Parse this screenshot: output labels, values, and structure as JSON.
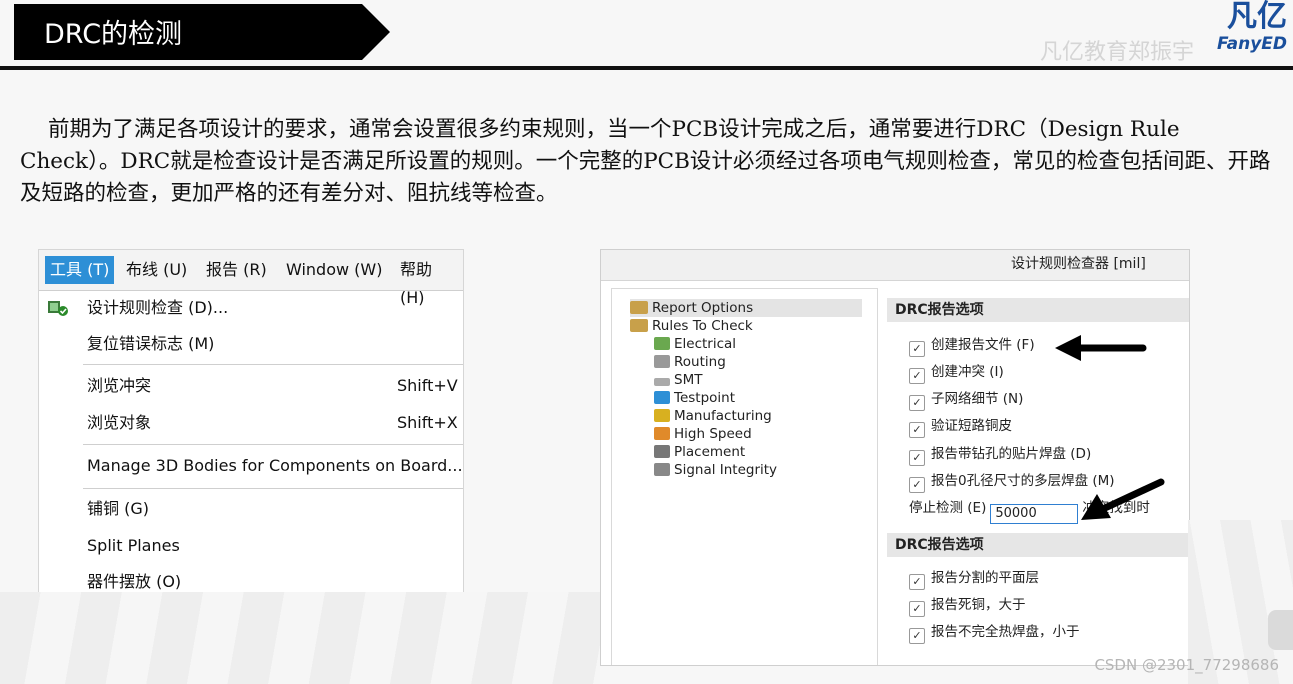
{
  "header": {
    "title": "DRC的检测",
    "logo_cn": "凡亿",
    "logo_en": "FanyED",
    "watermark": "凡亿教育郑振宇"
  },
  "paragraph": {
    "text": "前期为了满足各项设计的要求，通常会设置很多约束规则，当一个PCB设计完成之后，通常要进行DRC（Design Rule Check）。DRC就是检查设计是否满足所设置的规则。一个完整的PCB设计必须经过各项电气规则检查，常见的检查包括间距、开路及短路的检查，更加严格的还有差分对、阻抗线等检查。"
  },
  "menu": {
    "bar": [
      {
        "label": "工具 (T)"
      },
      {
        "label": "布线 (U)"
      },
      {
        "label": "报告 (R)"
      },
      {
        "label": "Window (W)"
      },
      {
        "label": "帮助 (H)"
      }
    ],
    "items": [
      {
        "label": "设计规则检查 (D)...",
        "shortcut": ""
      },
      {
        "label": "复位错误标志 (M)",
        "shortcut": ""
      },
      {
        "label": "浏览冲突",
        "shortcut": "Shift+V"
      },
      {
        "label": "浏览对象",
        "shortcut": "Shift+X"
      },
      {
        "label": "Manage 3D Bodies for Components on Board...",
        "shortcut": ""
      },
      {
        "label": "铺铜 (G)",
        "shortcut": ""
      },
      {
        "label": "Split Planes",
        "shortcut": ""
      },
      {
        "label": "器件摆放 (O)",
        "shortcut": ""
      }
    ]
  },
  "dialog": {
    "title": "设计规则检查器 [mil]",
    "tree": [
      {
        "label": "Report Options",
        "icon": "folder-icon",
        "color": "#c8a04a"
      },
      {
        "label": "Rules To Check",
        "icon": "folder-icon",
        "color": "#c8a04a"
      },
      {
        "label": "Electrical",
        "icon": "electrical-icon",
        "color": "#6aa84f"
      },
      {
        "label": "Routing",
        "icon": "routing-icon",
        "color": "#999999"
      },
      {
        "label": "SMT",
        "icon": "smt-icon",
        "color": "#aaaaaa"
      },
      {
        "label": "Testpoint",
        "icon": "testpoint-icon",
        "color": "#2d8fd6"
      },
      {
        "label": "Manufacturing",
        "icon": "manufacturing-icon",
        "color": "#d8b020"
      },
      {
        "label": "High Speed",
        "icon": "high-speed-icon",
        "color": "#e08a2a"
      },
      {
        "label": "Placement",
        "icon": "placement-icon",
        "color": "#777777"
      },
      {
        "label": "Signal Integrity",
        "icon": "signal-integrity-icon",
        "color": "#888888"
      }
    ],
    "section1_title": "DRC报告选项",
    "options1": [
      {
        "label": "创建报告文件 (F)",
        "checked": true
      },
      {
        "label": "创建冲突 (I)",
        "checked": true
      },
      {
        "label": "子网络细节 (N)",
        "checked": true
      },
      {
        "label": "验证短路铜皮",
        "checked": true
      },
      {
        "label": "报告带钻孔的贴片焊盘 (D)",
        "checked": true
      },
      {
        "label": "报告0孔径尺寸的多层焊盘 (M)",
        "checked": true
      }
    ],
    "stop_label": "停止检测 (E)",
    "stop_value": "50000",
    "stop_suffix": "冲突找到时",
    "section2_title": "DRC报告选项",
    "options2": [
      {
        "label": "报告分割的平面层",
        "checked": true
      },
      {
        "label": "报告死铜，大于",
        "checked": true
      },
      {
        "label": "报告不完全热焊盘，小于",
        "checked": true
      }
    ]
  },
  "footer": {
    "csdn": "CSDN @2301_77298686"
  }
}
